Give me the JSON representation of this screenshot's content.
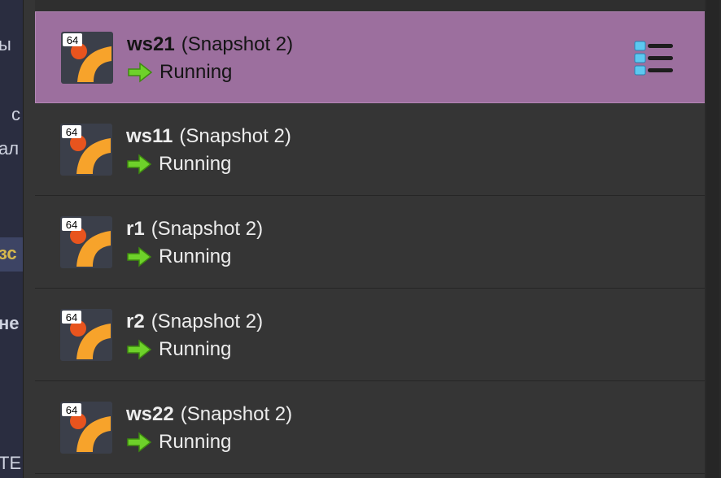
{
  "background_fragments": [
    "ы",
    "с",
    "ал",
    "зс",
    "не",
    "ТЕ"
  ],
  "vm_list": [
    {
      "name": "ws21",
      "snapshot": "(Snapshot 2)",
      "state": "Running",
      "badge": "64",
      "selected": true
    },
    {
      "name": "ws11",
      "snapshot": "(Snapshot 2)",
      "state": "Running",
      "badge": "64",
      "selected": false
    },
    {
      "name": "r1",
      "snapshot": "(Snapshot 2)",
      "state": "Running",
      "badge": "64",
      "selected": false
    },
    {
      "name": "r2",
      "snapshot": "(Snapshot 2)",
      "state": "Running",
      "badge": "64",
      "selected": false
    },
    {
      "name": "ws22",
      "snapshot": "(Snapshot 2)",
      "state": "Running",
      "badge": "64",
      "selected": false
    }
  ],
  "icons": {
    "os": "os-type-64bit-icon",
    "state": "running-arrow-icon",
    "details": "machine-tools-menu-icon"
  },
  "colors": {
    "selected_row": "#9c6f9e",
    "row": "#353535",
    "running_arrow": "#6ed12a",
    "icon_orange": "#f7a32b"
  }
}
